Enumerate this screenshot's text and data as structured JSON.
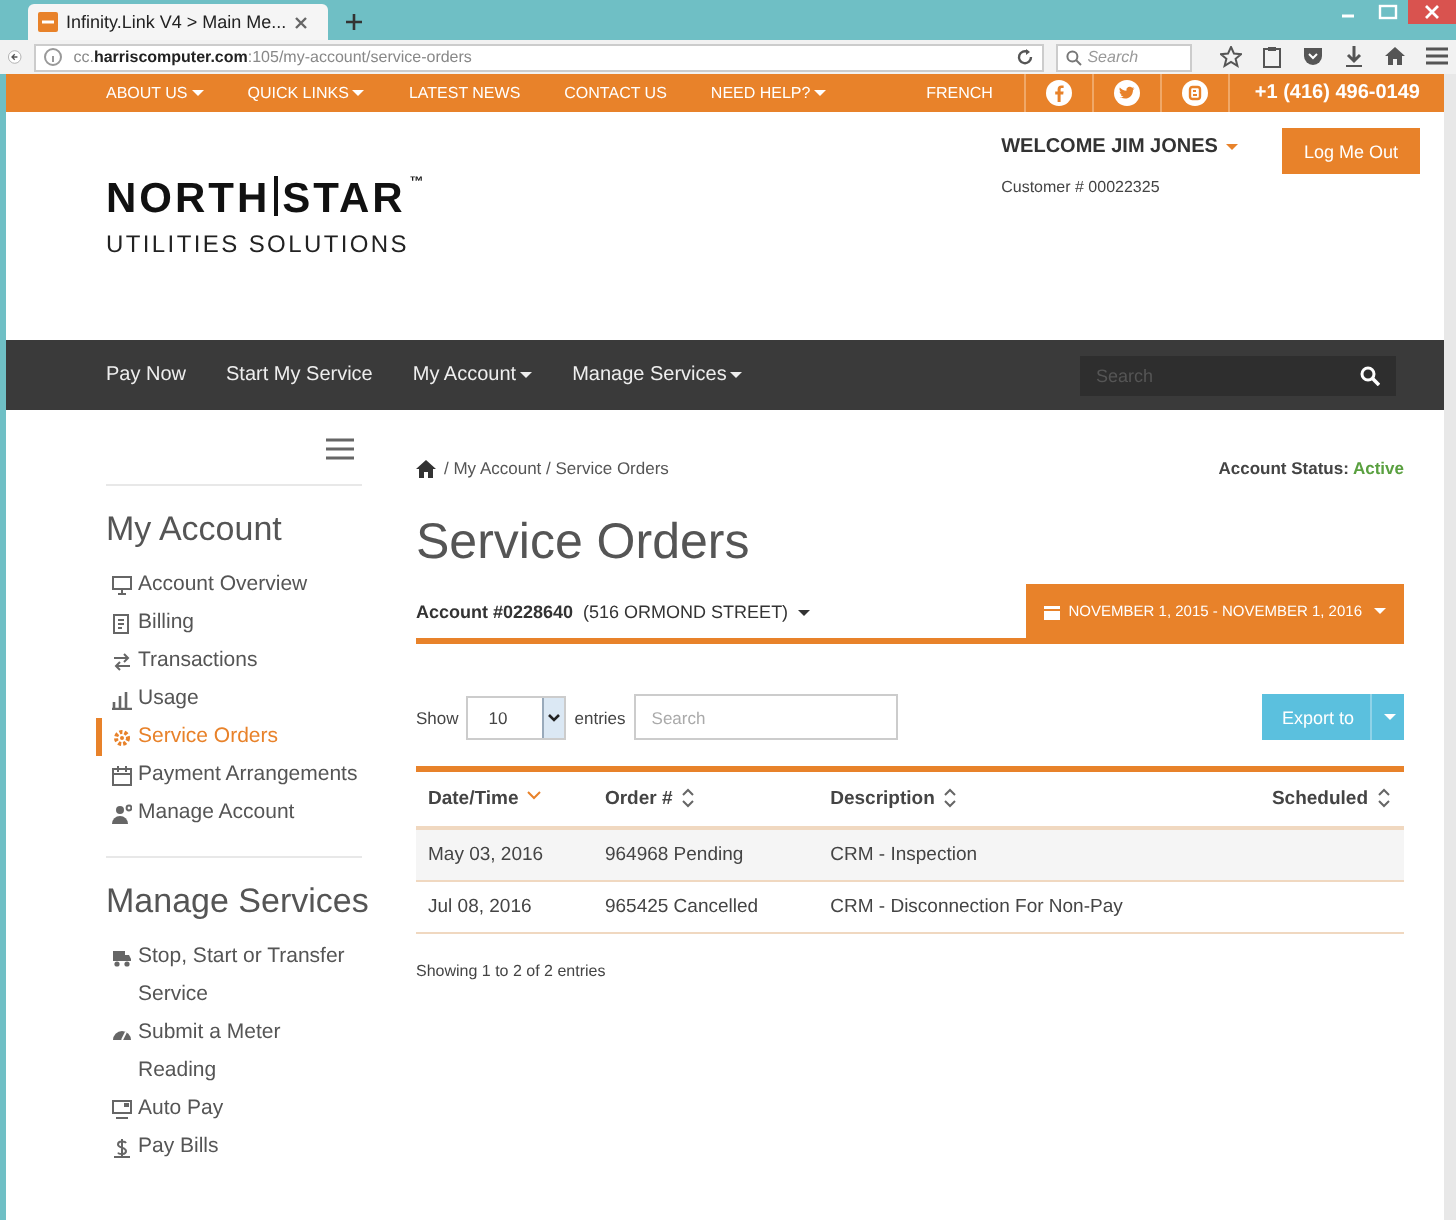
{
  "browser": {
    "tab_title": "Infinity.Link V4 > Main Me...",
    "url": "cc.**harriscomputer.com**:105/my-account/service-orders",
    "search_placeholder": "Search"
  },
  "top_nav": {
    "items": [
      {
        "label": "ABOUT US",
        "has_menu": true
      },
      {
        "label": "QUICK LINKS",
        "has_menu": true
      },
      {
        "label": "LATEST NEWS",
        "has_menu": false
      },
      {
        "label": "CONTACT US",
        "has_menu": false
      },
      {
        "label": "NEED HELP?",
        "has_menu": true
      }
    ],
    "language": "FRENCH",
    "social": [
      {
        "kind": "facebook"
      },
      {
        "kind": "twitter"
      },
      {
        "kind": "blog"
      }
    ],
    "phone": "+1 (416) 496-0149"
  },
  "header": {
    "logo_left": "NORTH",
    "logo_right": "STAR",
    "logo_mark": "™",
    "logo_subtitle": "UTILITIES SOLUTIONS",
    "welcome": "WELCOME JIM JONES",
    "customer": "Customer # 00022325",
    "logout": "Log Me Out"
  },
  "main_nav": {
    "items": [
      {
        "label": "Pay Now",
        "has_menu": false
      },
      {
        "label": "Start My Service",
        "has_menu": false
      },
      {
        "label": "My Account",
        "has_menu": true
      },
      {
        "label": "Manage Services",
        "has_menu": true
      }
    ],
    "search_placeholder": "Search"
  },
  "sidebar": {
    "sections": [
      {
        "title": "My Account",
        "items": [
          {
            "label": "Account Overview",
            "selected": false
          },
          {
            "label": "Billing",
            "selected": false
          },
          {
            "label": "Transactions",
            "selected": false
          },
          {
            "label": "Usage",
            "selected": false
          },
          {
            "label": "Service Orders",
            "selected": true
          },
          {
            "label": "Payment Arrangements",
            "selected": false
          },
          {
            "label": "Manage Account",
            "selected": false
          }
        ]
      },
      {
        "title": "Manage Services",
        "items": [
          {
            "label": "Stop, Start or Transfer Service",
            "selected": false
          },
          {
            "label": "Submit a Meter Reading",
            "selected": false
          },
          {
            "label": "Auto Pay",
            "selected": false
          },
          {
            "label": "Pay Bills",
            "selected": false
          }
        ]
      }
    ]
  },
  "breadcrumb": "/ My Account / Service Orders",
  "account_status": {
    "label": "Account Status:",
    "value": "Active"
  },
  "page_title": "Service Orders",
  "account": {
    "number": "Account #0228640",
    "address": "(516 ORMOND STREET)"
  },
  "date_range": "NOVEMBER 1, 2015 - NOVEMBER 1, 2016",
  "table_controls": {
    "show": "Show",
    "page_size": "10",
    "entries": "entries",
    "search_placeholder": "Search",
    "export": "Export to"
  },
  "table": {
    "columns": [
      {
        "label": "Date/Time",
        "sorted": true
      },
      {
        "label": "Order #",
        "sorted": false
      },
      {
        "label": "Description",
        "sorted": false
      },
      {
        "label": "Scheduled",
        "sorted": false
      }
    ],
    "rows": [
      [
        "May 03, 2016",
        "964968 Pending",
        "CRM - Inspection",
        null
      ],
      [
        "Jul 08, 2016",
        "965425 Cancelled",
        "CRM - Disconnection For Non-Pay",
        null
      ]
    ],
    "footer": "Showing 1 to 2 of 2 entries"
  }
}
